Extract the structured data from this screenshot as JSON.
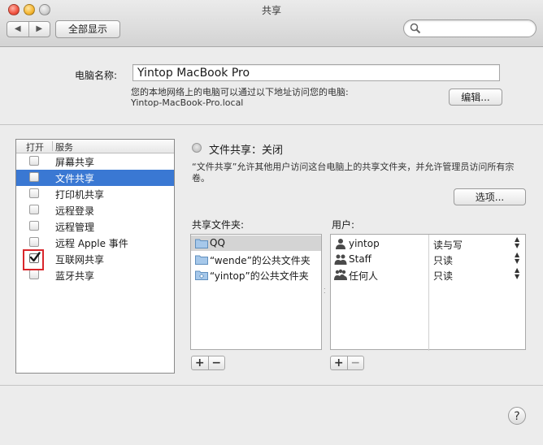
{
  "window": {
    "title": "共享"
  },
  "toolbar": {
    "back_icon": "chevron-left-icon",
    "forward_icon": "chevron-right-icon",
    "back_glyph": "◀",
    "forward_glyph": "▶",
    "show_all_label": "全部显示",
    "search_placeholder": ""
  },
  "computer": {
    "name_label": "电脑名称:",
    "name_value": "Yintop MacBook Pro",
    "info_line1": "您的本地网络上的电脑可以通过以下地址访问您的电脑:",
    "info_line2": "Yintop-MacBook-Pro.local",
    "edit_label": "编辑..."
  },
  "services": {
    "header_on": "打开",
    "header_service": "服务",
    "items": [
      {
        "label": "屏幕共享",
        "checked": false,
        "selected": false
      },
      {
        "label": "文件共享",
        "checked": false,
        "selected": true
      },
      {
        "label": "打印机共享",
        "checked": false,
        "selected": false
      },
      {
        "label": "远程登录",
        "checked": false,
        "selected": false
      },
      {
        "label": "远程管理",
        "checked": false,
        "selected": false
      },
      {
        "label": "远程 Apple 事件",
        "checked": false,
        "selected": false
      },
      {
        "label": "互联网共享",
        "checked": true,
        "selected": false
      },
      {
        "label": "蓝牙共享",
        "checked": false,
        "selected": false
      }
    ]
  },
  "file_sharing": {
    "status": "文件共享：关闭",
    "description_line1": "“文件共享”允许其他用户访问这台电脑上的共享文件夹，并允许管理员访问所有宗",
    "description_line2": "卷。",
    "options_label": "选项...",
    "shared_folders_label": "共享文件夹:",
    "users_label": "用户:",
    "folders": [
      {
        "name": "QQ",
        "selected": true,
        "icon": "folder-icon"
      },
      {
        "name": "“wende”的公共文件夹",
        "selected": false,
        "icon": "folder-icon"
      },
      {
        "name": "“yintop”的公共文件夹",
        "selected": false,
        "icon": "public-folder-icon"
      }
    ],
    "users": [
      {
        "name": "yintop",
        "permission": "读与写",
        "icon": "user-icon"
      },
      {
        "name": "Staff",
        "permission": "只读",
        "icon": "group-icon"
      },
      {
        "name": "任何人",
        "permission": "只读",
        "icon": "everyone-icon"
      }
    ],
    "add_label": "+",
    "remove_label": "−"
  },
  "help": {
    "label": "?"
  }
}
